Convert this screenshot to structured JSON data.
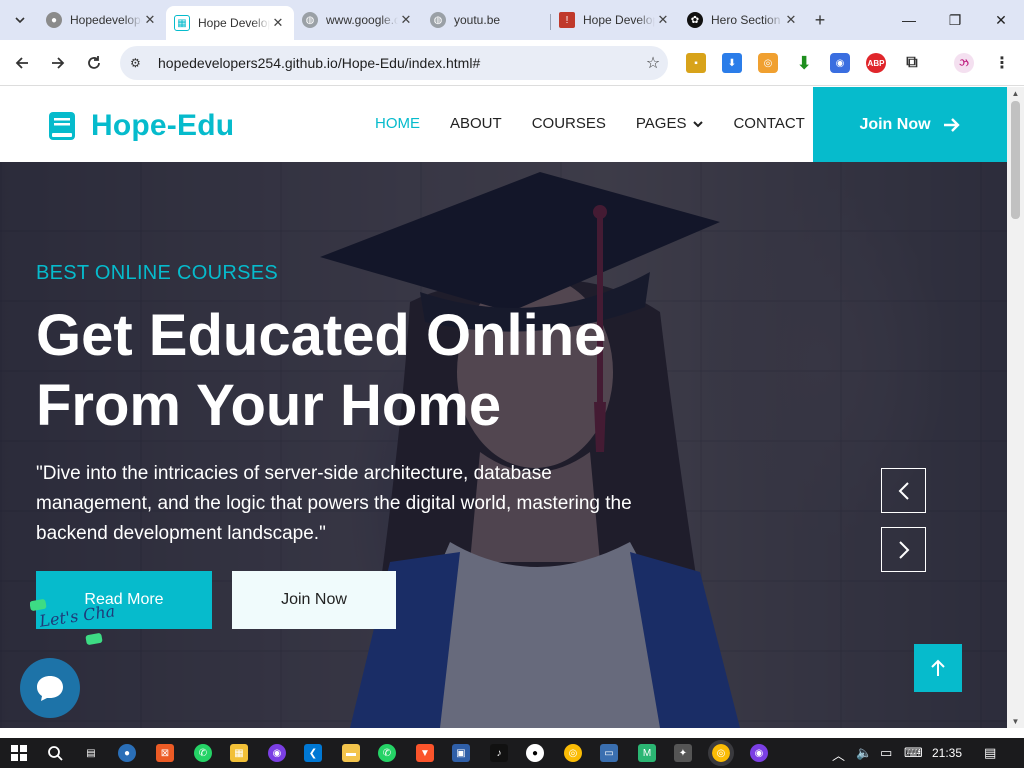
{
  "browser": {
    "tabs": [
      {
        "title": "Hopedevelopers",
        "active": false,
        "favicon": "github-icon"
      },
      {
        "title": "Hope Developers",
        "active": true,
        "favicon": "site-icon"
      },
      {
        "title": "www.google.com",
        "active": false,
        "favicon": "globe-icon"
      },
      {
        "title": "youtu.be",
        "active": false,
        "favicon": "globe-icon"
      },
      {
        "title": "Hope Developers",
        "active": false,
        "favicon": "site-icon"
      },
      {
        "title": "Hero Section",
        "active": false,
        "favicon": "openai-icon"
      }
    ],
    "url": "hopedevelopers254.github.io/Hope-Edu/index.html#"
  },
  "site": {
    "brand": "Hope-Edu",
    "nav": [
      {
        "label": "HOME",
        "active": true
      },
      {
        "label": "ABOUT",
        "active": false
      },
      {
        "label": "COURSES",
        "active": false
      },
      {
        "label": "PAGES",
        "active": false,
        "dropdown": true
      },
      {
        "label": "CONTACT",
        "active": false
      }
    ],
    "join_label": "Join Now",
    "accent_color": "#06bbcc"
  },
  "hero": {
    "kicker": "BEST ONLINE COURSES",
    "headline_line1": "Get Educated Online",
    "headline_line2": "From Your Home",
    "lead": "\"Dive into the intricacies of server-side architecture, database management, and the logic that powers the digital world, mastering the backend development landscape.\"",
    "primary_button": "Read More",
    "secondary_button": "Join Now",
    "chat_sticker_text": "Let's Chat"
  },
  "taskbar": {
    "time": "21:35"
  }
}
